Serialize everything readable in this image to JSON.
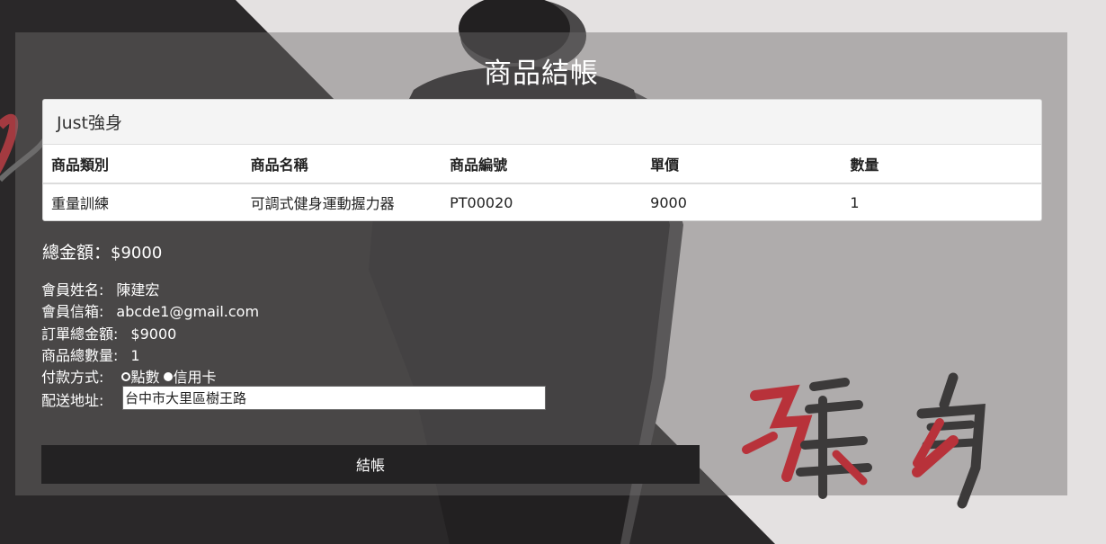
{
  "page": {
    "title": "商品結帳"
  },
  "card": {
    "header": "Just強身",
    "columns": [
      "商品類別",
      "商品名稱",
      "商品編號",
      "單價",
      "數量"
    ],
    "rows": [
      [
        "重量訓練",
        "可調式健身運動握力器",
        "PT00020",
        "9000",
        "1"
      ]
    ]
  },
  "summary": {
    "total_label": "總金額：",
    "total_value": "$9000"
  },
  "member": {
    "name_label": "會員姓名:",
    "name_value": "陳建宏",
    "email_label": "會員信箱:",
    "email_value": "abcde1@gmail.com",
    "order_total_label": "訂單總金額:",
    "order_total_value": "$9000",
    "qty_label": "商品總數量:",
    "qty_value": "1",
    "payment_label": "付款方式:",
    "payment_options": [
      "點數",
      "信用卡"
    ],
    "payment_selected": "信用卡",
    "address_label": "配送地址:",
    "address_value": "台中市大里區樹王路"
  },
  "buttons": {
    "checkout": "結帳"
  },
  "decor": {
    "calligraphy": "強身"
  },
  "colors": {
    "dark": "#232223",
    "accent_red": "#b8323a"
  }
}
